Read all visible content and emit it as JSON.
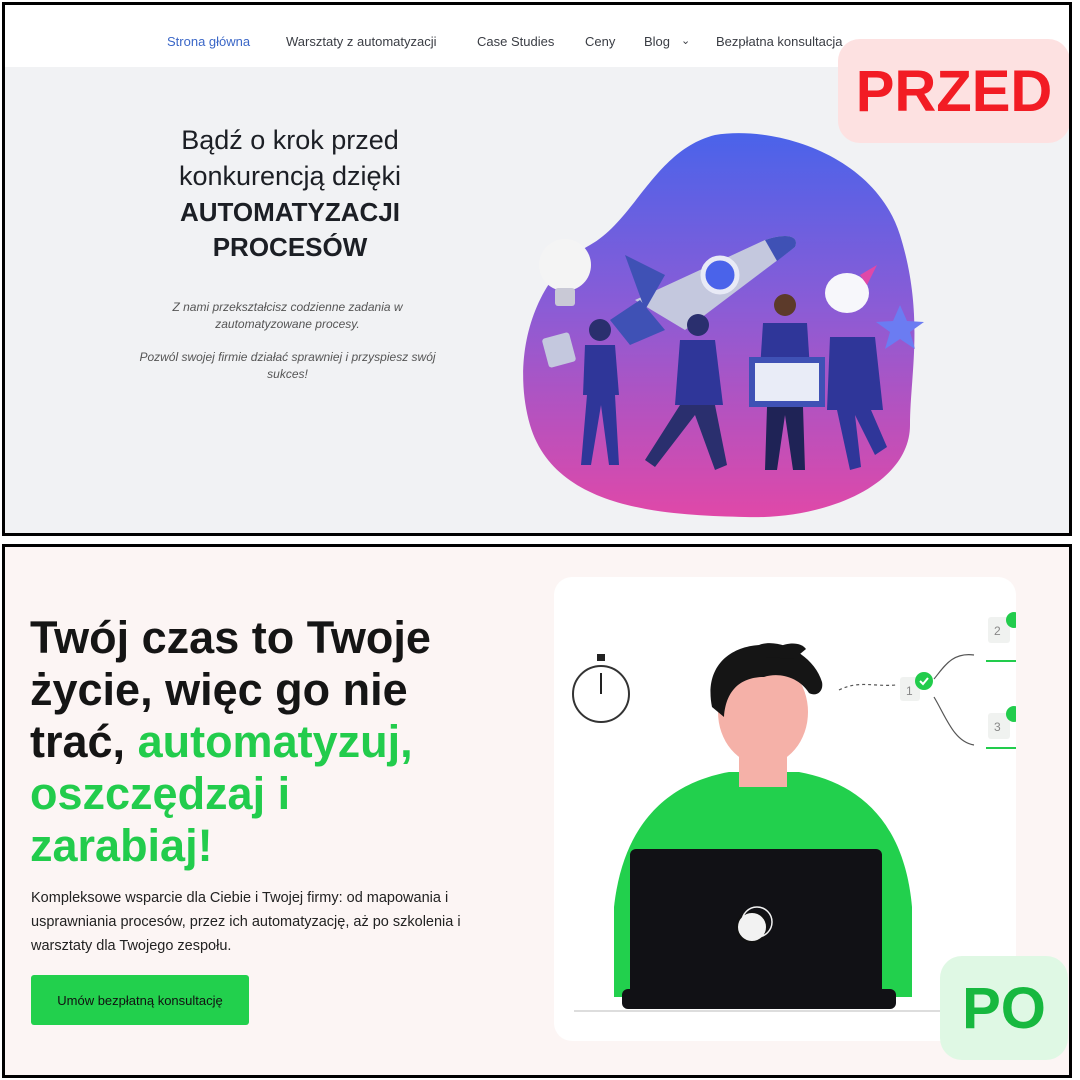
{
  "before": {
    "badge": "PRZED",
    "nav": {
      "items": [
        "Strona główna",
        "Warsztaty z automatyzacji",
        "Case Studies",
        "Ceny",
        "Blog",
        "Bezpłatna konsultacja"
      ]
    },
    "hero": {
      "line1": "Bądź o krok przed",
      "line2": "konkurencją dzięki",
      "line3": "AUTOMATYZACJI",
      "line4": "PROCESÓW",
      "p1_line1": "Z nami przekształcisz codzienne zadania w",
      "p1_line2": "zautomatyzowane procesy.",
      "p2_line1": "Pozwól swojej firmie działać sprawniej i przyspiesz swój",
      "p2_line2": "sukces!"
    }
  },
  "after": {
    "badge": "PO",
    "headline": {
      "line1": "Twój czas to Twoje",
      "line2": "życie, więc go nie",
      "line3_plain": "trać, ",
      "line3_green": "automatyzuj,",
      "line4": "oszczędzaj i",
      "line5": "zarabiaj!"
    },
    "description": {
      "line1": "Kompleksowe wsparcie dla Ciebie i Twojej firmy: od mapowania i",
      "line2": "usprawniania procesów, przez ich automatyzację, aż po szkolenia i",
      "line3": "warsztaty dla Twojego zespołu."
    },
    "cta_label": "Umów bezpłatną konsultację",
    "flow_steps": [
      "1",
      "2",
      "3"
    ]
  },
  "colors": {
    "active_nav": "#3b67c7",
    "badge_red": "#f21c24",
    "badge_green": "#17b83f",
    "accent_green": "#22cc4c"
  }
}
